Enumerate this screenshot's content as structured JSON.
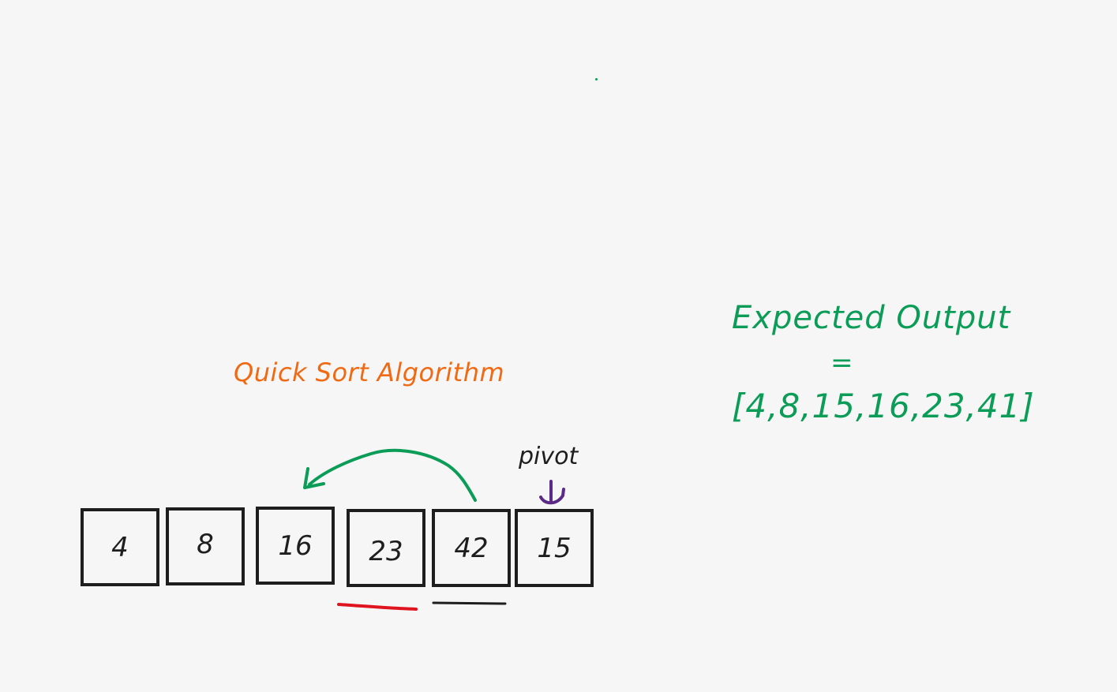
{
  "diagram": {
    "title": "Quick Sort Algorithm",
    "array": [
      "4",
      "8",
      "16",
      "23",
      "42",
      "15"
    ],
    "pivot_label": "pivot",
    "expected": {
      "title": "Expected Output",
      "equals": "=",
      "value": "[4,8,15,16,23,41]"
    }
  },
  "colors": {
    "background": "#f6f6f6",
    "title": "#f06a14",
    "expected": "#0b9d57",
    "arrow": "#0b9d57",
    "pivot_arrow": "#5b2a86",
    "left_underline": "#e0141e",
    "right_underline": "#1e1e1e",
    "box_stroke": "#1e1e1e"
  },
  "icons": {
    "swap_arrow": "curved-arrow-left-icon",
    "pivot_arrow": "down-arrow-icon"
  }
}
